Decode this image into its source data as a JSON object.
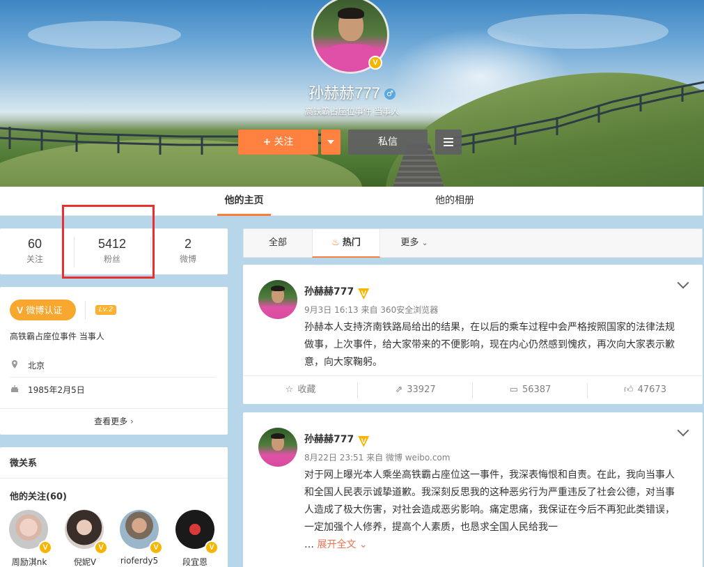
{
  "profile": {
    "name": "孙赫赫777",
    "gender_symbol": "♂",
    "description": "高铁霸占座位事件 当事人",
    "follow_label": "关注",
    "follow_plus": "+",
    "message_label": "私信",
    "verified_badge": "V"
  },
  "tabs": [
    {
      "label": "他的主页"
    },
    {
      "label": "他的相册"
    }
  ],
  "stats": [
    {
      "value": "60",
      "label": "关注"
    },
    {
      "value": "5412",
      "label": "粉丝"
    },
    {
      "value": "2",
      "label": "微博"
    }
  ],
  "info": {
    "verify_label": "微博认证",
    "verify_icon": "V",
    "level": "Lv.2",
    "description": "高铁霸占座位事件 当事人",
    "location": "北京",
    "birthday": "1985年2月5日",
    "see_more": "查看更多",
    "location_icon": "location-pin-icon",
    "birthday_icon": "cake-icon"
  },
  "relations": {
    "title": "微关系",
    "following_title": "他的关注(60)",
    "users": [
      {
        "name": "周励淇nk"
      },
      {
        "name": "倪妮V"
      },
      {
        "name": "rioferdy5"
      },
      {
        "name": "段宜恩"
      }
    ]
  },
  "feed_tabs": [
    {
      "label": "全部"
    },
    {
      "label": "热门",
      "icon": "flame-icon"
    },
    {
      "label": "更多"
    }
  ],
  "posts": [
    {
      "author": "孙赫赫777",
      "meta": "9月3日 16:13 来自 360安全浏览器",
      "body": "孙赫本人支持济南铁路局给出的结果，在以后的乘车过程中会严格按照国家的法律法规做事，上次事件，给大家带来的不便影响，现在内心仍然感到愧疚，再次向大家表示歉意，向大家鞠躬。",
      "actions": [
        {
          "label": "收藏",
          "icon": "star-icon"
        },
        {
          "label": "33927",
          "icon": "share-icon"
        },
        {
          "label": "56387",
          "icon": "comment-icon"
        },
        {
          "label": "47673",
          "icon": "like-icon"
        }
      ]
    },
    {
      "author": "孙赫赫777",
      "meta": "8月22日 23:51 来自 微博 weibo.com",
      "body": "对于网上曝光本人乘坐高铁霸占座位这一事件，我深表悔恨和自责。在此，我向当事人和全国人民表示诚挚道歉。我深刻反思我的这种恶劣行为严重违反了社会公德，对当事人造成了极大伤害，对社会造成恶劣影响。痛定思痛，我保证在今后不再犯此类错误，一定加强个人修养，提高个人素质，也恳求全国人民给我一",
      "ellipsis": "…",
      "expand_label": "展开全文"
    }
  ],
  "colors": {
    "accent": "#fa7d3c",
    "follow_button": "#ff8140",
    "verified": "#f7b500",
    "highlight_box": "#e8312f",
    "background": "#b7d6ea"
  }
}
